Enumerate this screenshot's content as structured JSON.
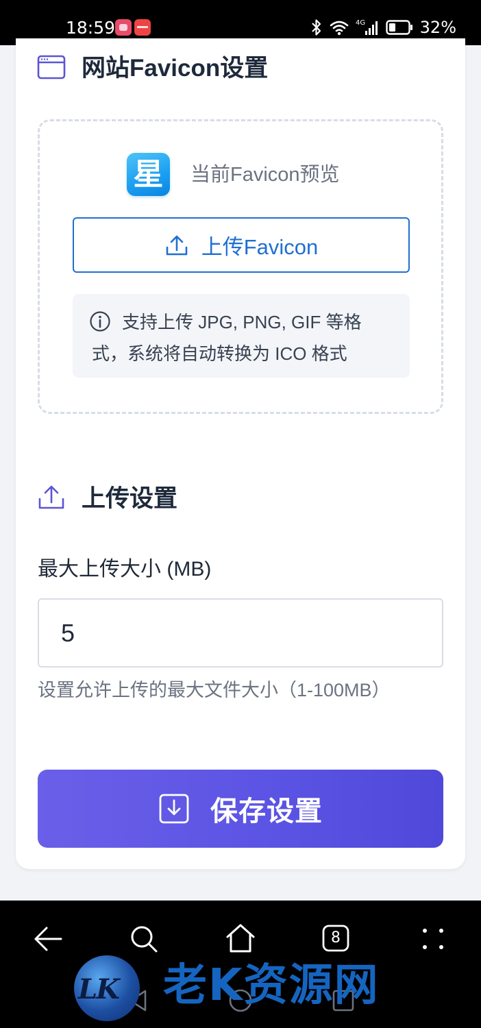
{
  "status_bar": {
    "time": "18:59",
    "battery_percent": "32%",
    "network_label": "4G",
    "icons": [
      "app-notification-icon",
      "app-notification-icon",
      "bluetooth-icon",
      "wifi-icon",
      "cellular-signal-icon",
      "battery-icon"
    ]
  },
  "favicon_section": {
    "title": "网站Favicon设置",
    "icon": "browser-window-icon",
    "current_favicon_glyph": "星",
    "preview_label": "当前Favicon预览",
    "upload_button_label": "上传Favicon",
    "upload_icon": "upload-icon",
    "hint_icon": "info-icon",
    "hint_text": "支持上传 JPG, PNG, GIF 等格式，系统将自动转换为 ICO 格式"
  },
  "upload_section": {
    "title": "上传设置",
    "icon": "upload-icon",
    "max_size_label": "最大上传大小 (MB)",
    "max_size_value": "5",
    "max_size_help": "设置允许上传的最大文件大小（1-100MB）"
  },
  "save_button": {
    "label": "保存设置",
    "icon": "save-download-icon"
  },
  "nav_bar": {
    "tab_count": "8",
    "buttons": [
      "back-icon",
      "search-icon",
      "home-icon",
      "tabs-icon",
      "more-icon",
      "system-back-icon",
      "system-home-icon",
      "system-recents-icon"
    ]
  },
  "watermark": {
    "badge_text": "LK",
    "text": "老K资源网"
  },
  "colors": {
    "accent_purple": "#5c54e4",
    "link_blue": "#1f6fd0",
    "card_background": "#ffffff",
    "page_background": "#f1f3f6",
    "system_bar": "#000000"
  }
}
